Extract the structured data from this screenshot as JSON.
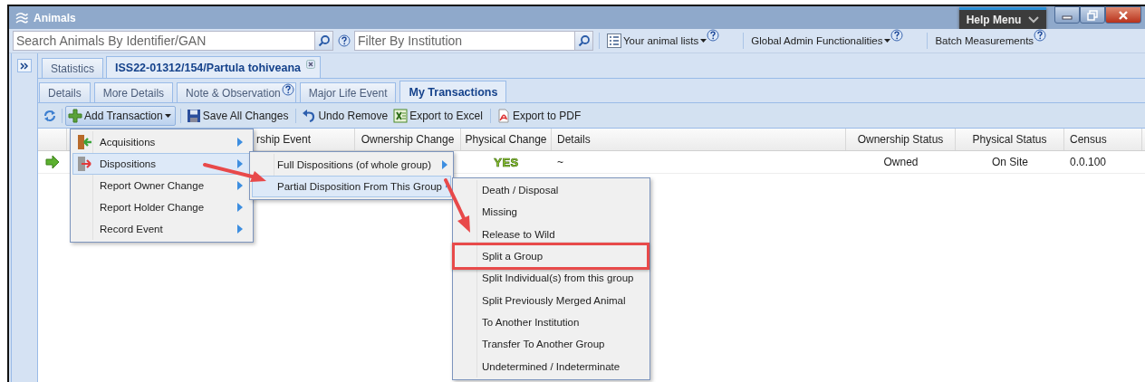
{
  "window": {
    "title": "Animals"
  },
  "help_menu": {
    "label": "Help Menu"
  },
  "toolbar": {
    "search": {
      "placeholder": "Search Animals By Identifier/GAN"
    },
    "filter": {
      "placeholder": "Filter By Institution"
    },
    "items": [
      {
        "label": "Your animal lists",
        "kind": "list",
        "dropdown": true,
        "help": true
      },
      {
        "label": "Global Admin Functionalities",
        "kind": "plain",
        "dropdown": true,
        "help": true
      },
      {
        "label": "Batch Measurements",
        "kind": "plain",
        "dropdown": false,
        "help": true
      }
    ]
  },
  "tabs": [
    {
      "label": "Statistics",
      "selected": false,
      "closable": false
    },
    {
      "label": "ISS22-01312/154/Partula tohiveana",
      "selected": true,
      "closable": true
    }
  ],
  "subtabs": [
    {
      "label": "Details",
      "selected": false,
      "help": false
    },
    {
      "label": "More Details",
      "selected": false,
      "help": false
    },
    {
      "label": "Note & Observation",
      "selected": false,
      "help": true
    },
    {
      "label": "Major Life Event",
      "selected": false,
      "help": false
    },
    {
      "label": "My Transactions",
      "selected": true,
      "help": false
    }
  ],
  "actions": [
    {
      "label": "Add Transaction",
      "kind": "add",
      "pressed": true
    },
    {
      "label": "Save All Changes",
      "kind": "save",
      "pressed": false
    },
    {
      "label": "Undo Remove",
      "kind": "undo",
      "pressed": false
    },
    {
      "label": "Export to Excel",
      "kind": "excel",
      "pressed": false
    },
    {
      "label": "Export to PDF",
      "kind": "pdf",
      "pressed": false
    }
  ],
  "table": {
    "current_row": true,
    "columns": [
      {
        "header": "rship Event"
      },
      {
        "header": "Ownership Change"
      },
      {
        "header": "Physical Change",
        "cell": "YES",
        "kind": "badge"
      },
      {
        "header": "Details",
        "cell": "~",
        "kind": "text"
      },
      {
        "header": "Ownership Status",
        "cell": "Owned",
        "kind": "text"
      },
      {
        "header": "Physical Status",
        "cell": "On Site",
        "kind": "text"
      },
      {
        "header": "Census",
        "cell": "0.0.100",
        "kind": "text"
      }
    ]
  },
  "add_transaction_menu": {
    "items": [
      {
        "label": "Acquisitions",
        "kind": "in",
        "selected": false
      },
      {
        "label": "Dispositions",
        "kind": "out",
        "selected": true
      },
      {
        "label": "Report Owner Change",
        "kind": "plain",
        "selected": false
      },
      {
        "label": "Report Holder Change",
        "kind": "plain",
        "selected": false
      },
      {
        "label": "Record Event",
        "kind": "plain",
        "selected": false
      }
    ]
  },
  "dispositions_menu": {
    "items": [
      {
        "label": "Full Dispositions (of whole group)",
        "selected": false
      },
      {
        "label": "Partial Disposition From This Group",
        "selected": true
      }
    ]
  },
  "partial_disposition_menu": {
    "items": [
      {
        "label": "Death / Disposal",
        "annotated": false
      },
      {
        "label": "Missing",
        "annotated": false
      },
      {
        "label": "Release to Wild",
        "annotated": false
      },
      {
        "label": "Split a Group",
        "annotated": true
      },
      {
        "label": "Split Individual(s) from this group",
        "annotated": false
      },
      {
        "label": "Split Previously Merged Animal",
        "annotated": false
      },
      {
        "label": "To Another Institution",
        "annotated": false
      },
      {
        "label": "Transfer To Another Group",
        "annotated": false
      },
      {
        "label": "Undetermined / Indeterminate",
        "annotated": false
      }
    ]
  }
}
